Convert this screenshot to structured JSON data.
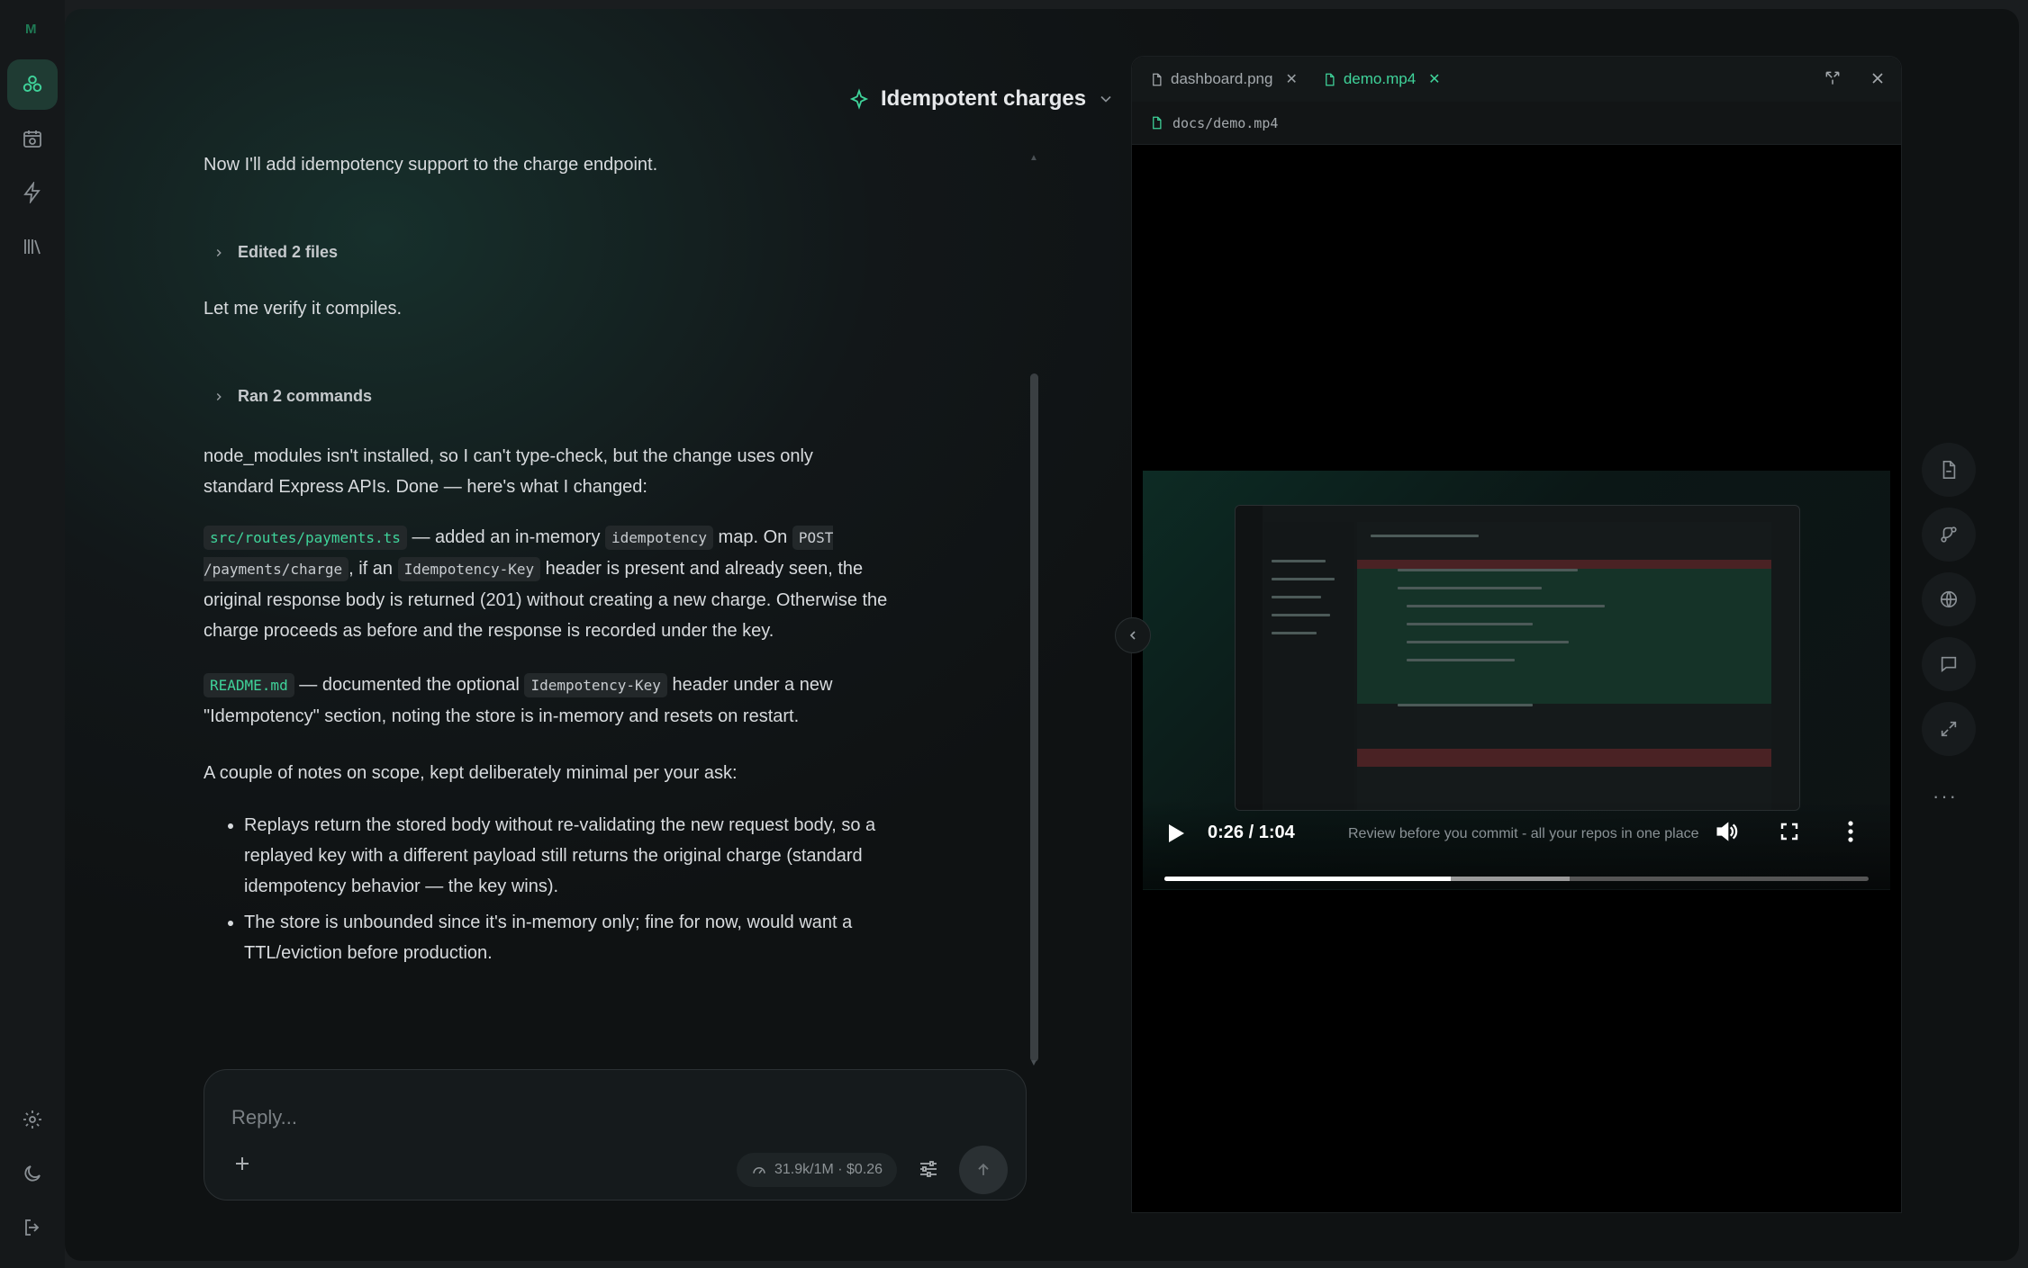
{
  "app": {
    "logo_text": "M"
  },
  "chat": {
    "title": "Idempotent charges",
    "intro": "Now I'll add idempotency support to the charge endpoint.",
    "edited_label": "Edited 2 files",
    "verify": "Let me verify it compiles.",
    "ran_label": "Ran 2 commands",
    "summary": "node_modules isn't installed, so I can't type-check, but the change uses only standard Express APIs. Done — here's what I changed:",
    "change1": {
      "file": "src/routes/payments.ts",
      "t1": " — added an in-memory ",
      "code1": "idempotency",
      "t2": " map. On ",
      "code2": "POST /payments/charge",
      "t3": ", if an ",
      "code3": "Idempotency-Key",
      "t4": " header is present and already seen, the original response body is returned (201) without creating a new charge. Otherwise the charge proceeds as before and the response is recorded under the key."
    },
    "change2": {
      "file": "README.md",
      "t1": " — documented the optional ",
      "code1": "Idempotency-Key",
      "t2": " header under a new \"Idempotency\" section, noting the store is in-memory and resets on restart."
    },
    "notes_intro": "A couple of notes on scope, kept deliberately minimal per your ask:",
    "notes": [
      "Replays return the stored body without re-validating the new request body, so a replayed key with a different payload still returns the original charge (standard idempotency behavior — the key wins).",
      "The store is unbounded since it's in-memory only; fine for now, would want a TTL/eviction before production."
    ]
  },
  "reply": {
    "placeholder": "Reply...",
    "usage": "31.9k/1M · $0.26"
  },
  "preview": {
    "tabs": [
      {
        "label": "dashboard.png",
        "active": false
      },
      {
        "label": "demo.mp4",
        "active": true
      }
    ],
    "path": "docs/demo.mp4",
    "video": {
      "time": "0:26 / 1:04",
      "caption": "Review before you commit - all your repos in one place",
      "progress": 0.407,
      "buffered": 0.575
    }
  },
  "colors": {
    "accent": "#3fd39a",
    "background": "#121719",
    "panel": "#000000"
  },
  "icons": {
    "rail": [
      "agents-icon",
      "schedule-icon",
      "lightning-icon",
      "library-icon",
      "settings-icon",
      "moon-icon",
      "logout-icon"
    ],
    "right_rail": [
      "file-icon",
      "git-branch-icon",
      "globe-icon",
      "comment-icon",
      "expand-icon",
      "more-icon"
    ]
  }
}
